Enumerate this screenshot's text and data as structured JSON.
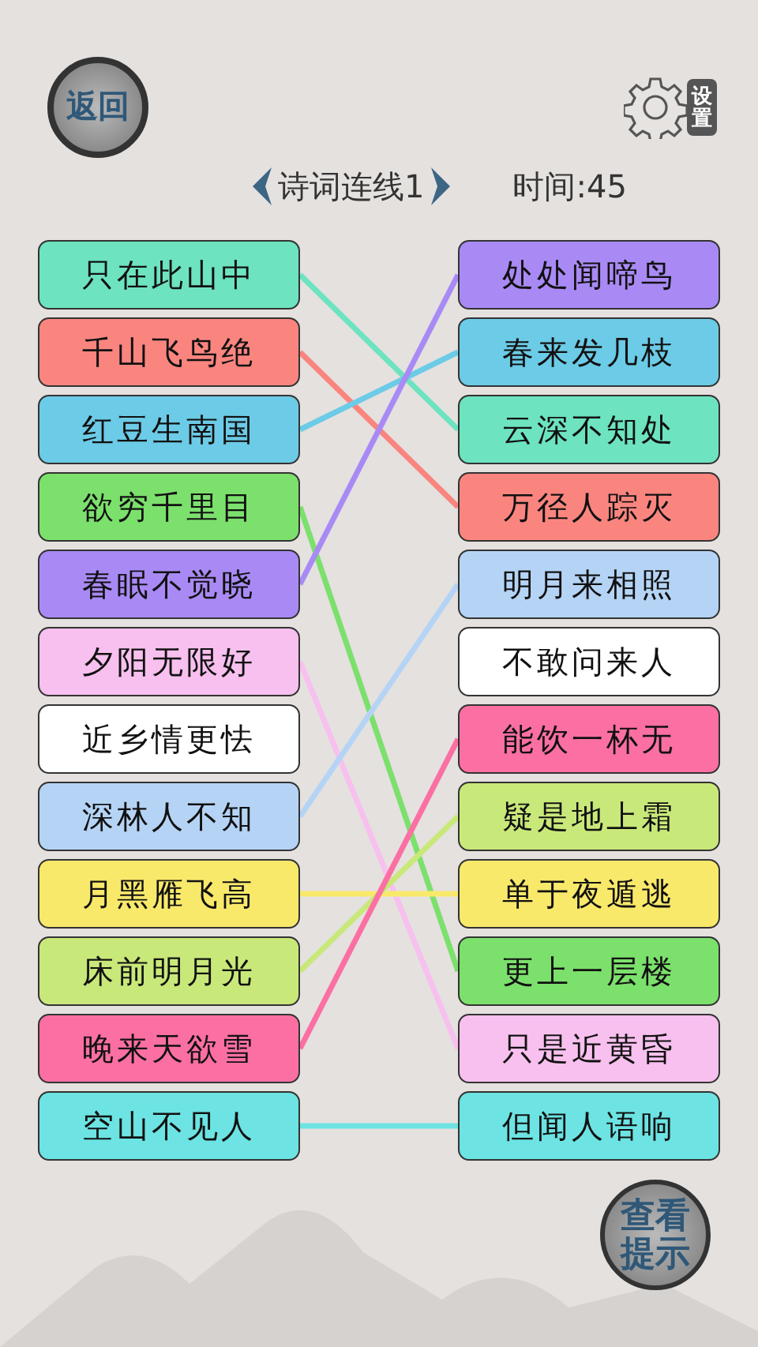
{
  "back_button": {
    "label": "返回"
  },
  "settings_button": {
    "label": "设置"
  },
  "title": "诗词连线1",
  "timer": "时间:45",
  "left": [
    {
      "text": "只在此山中",
      "color": "#6de3c0"
    },
    {
      "text": "千山飞鸟绝",
      "color": "#fa857f"
    },
    {
      "text": "红豆生南国",
      "color": "#6ccbe6"
    },
    {
      "text": "欲穷千里目",
      "color": "#7ce06c"
    },
    {
      "text": "春眠不觉晓",
      "color": "#a98af5"
    },
    {
      "text": "夕阳无限好",
      "color": "#f7c0ee"
    },
    {
      "text": "近乡情更怯",
      "color": "#ffffff"
    },
    {
      "text": "深林人不知",
      "color": "#b5d4f5"
    },
    {
      "text": "月黑雁飞高",
      "color": "#f9e96b"
    },
    {
      "text": "床前明月光",
      "color": "#c9e87a"
    },
    {
      "text": "晚来天欲雪",
      "color": "#fb6fa3"
    },
    {
      "text": "空山不见人",
      "color": "#6de3e3"
    }
  ],
  "right": [
    {
      "text": "处处闻啼鸟",
      "color": "#a98af5"
    },
    {
      "text": "春来发几枝",
      "color": "#6ccbe6"
    },
    {
      "text": "云深不知处",
      "color": "#6de3c0"
    },
    {
      "text": "万径人踪灭",
      "color": "#fa857f"
    },
    {
      "text": "明月来相照",
      "color": "#b5d4f5"
    },
    {
      "text": "不敢问来人",
      "color": "#ffffff"
    },
    {
      "text": "能饮一杯无",
      "color": "#fb6fa3"
    },
    {
      "text": "疑是地上霜",
      "color": "#c9e87a"
    },
    {
      "text": "单于夜遁逃",
      "color": "#f9e96b"
    },
    {
      "text": "更上一层楼",
      "color": "#7ce06c"
    },
    {
      "text": "只是近黄昏",
      "color": "#f7c0ee"
    },
    {
      "text": "但闻人语响",
      "color": "#6de3e3"
    }
  ],
  "hint_button": {
    "label": "查看提示"
  }
}
